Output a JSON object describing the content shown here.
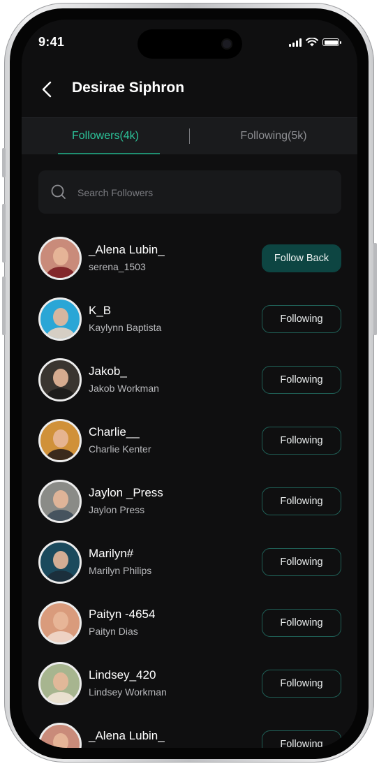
{
  "status_bar": {
    "time": "9:41"
  },
  "header": {
    "title": "Desirae Siphron"
  },
  "tabs": [
    {
      "label": "Followers(4k)",
      "active": true
    },
    {
      "label": "Following(5k)",
      "active": false
    }
  ],
  "search": {
    "placeholder": "Search Followers",
    "value": ""
  },
  "colors": {
    "accent": "#2cc49a",
    "primary_button": "#0d4542",
    "outline_border": "#1f5e55",
    "background": "#0f0f10"
  },
  "followers": [
    {
      "username": "_Alena Lubin_",
      "fullname": "serena_1503",
      "action": "Follow Back",
      "variant": "primary",
      "bg": "#c98b7a",
      "shirt": "#7b1d22"
    },
    {
      "username": "K_B",
      "fullname": "Kaylynn Baptista",
      "action": "Following",
      "variant": "outline",
      "bg": "#2aa6d6",
      "shirt": "#e8d3c2"
    },
    {
      "username": "Jakob_",
      "fullname": "Jakob Workman",
      "action": "Following",
      "variant": "outline",
      "bg": "#3a3530",
      "shirt": "#1b1a19"
    },
    {
      "username": "Charlie__",
      "fullname": "Charlie Kenter",
      "action": "Following",
      "variant": "outline",
      "bg": "#d09139",
      "shirt": "#2a1f1a"
    },
    {
      "username": "Jaylon _Press",
      "fullname": "Jaylon Press",
      "action": "Following",
      "variant": "outline",
      "bg": "#8a8b87",
      "shirt": "#3e4c5a"
    },
    {
      "username": "Marilyn#",
      "fullname": "Marilyn Philips",
      "action": "Following",
      "variant": "outline",
      "bg": "#1b4a5d",
      "shirt": "#1c2c38"
    },
    {
      "username": "Paityn -4654",
      "fullname": "Paityn Dias",
      "action": "Following",
      "variant": "outline",
      "bg": "#d99b7c",
      "shirt": "#f0d8cb"
    },
    {
      "username": "Lindsey_420",
      "fullname": "Lindsey Workman",
      "action": "Following",
      "variant": "outline",
      "bg": "#a7b58f",
      "shirt": "#f1e4d6"
    },
    {
      "username": "_Alena Lubin_",
      "fullname": "",
      "action": "Following",
      "variant": "outline",
      "bg": "#c98b7a",
      "shirt": "#7b1d22"
    }
  ]
}
